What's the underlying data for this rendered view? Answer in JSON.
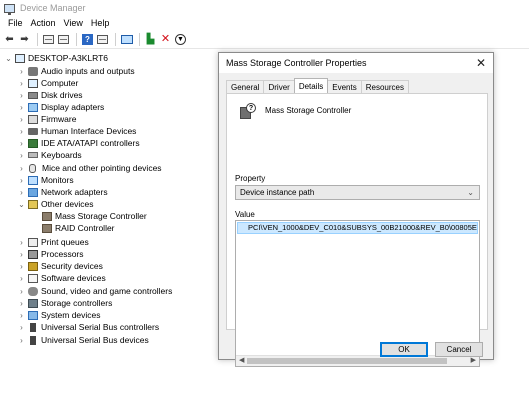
{
  "window": {
    "title": "Device Manager"
  },
  "menu": [
    "File",
    "Action",
    "View",
    "Help"
  ],
  "toolbar": {
    "icons": [
      "back-arrow-icon",
      "forward-arrow-icon",
      "properties-icon",
      "show-hidden-icon",
      "help-icon",
      "update-driver-icon",
      "monitor-icon",
      "add-hardware-icon",
      "uninstall-icon",
      "disable-icon"
    ],
    "help_glyph": "?"
  },
  "tree": {
    "root": "DESKTOP-A3KLRT6",
    "items": [
      "Audio inputs and outputs",
      "Computer",
      "Disk drives",
      "Display adapters",
      "Firmware",
      "Human Interface Devices",
      "IDE ATA/ATAPI controllers",
      "Keyboards",
      "Mice and other pointing devices",
      "Monitors",
      "Network adapters",
      "Other devices",
      "Mass Storage Controller",
      "RAID Controller",
      "Print queues",
      "Processors",
      "Security devices",
      "Software devices",
      "Sound, video and game controllers",
      "Storage controllers",
      "System devices",
      "Universal Serial Bus controllers",
      "Universal Serial Bus devices"
    ]
  },
  "dialog": {
    "title": "Mass Storage Controller Properties",
    "close_glyph": "✕",
    "tabs": [
      "General",
      "Driver",
      "Details",
      "Events",
      "Resources"
    ],
    "active_tab": "Details",
    "device_name": "Mass Storage Controller",
    "property_label": "Property",
    "property_value": "Device instance path",
    "value_label": "Value",
    "value_text": "PCI\\VEN_1000&DEV_C010&SUBSYS_00B21000&REV_B0\\00805E104(",
    "ok_label": "OK",
    "cancel_label": "Cancel"
  }
}
